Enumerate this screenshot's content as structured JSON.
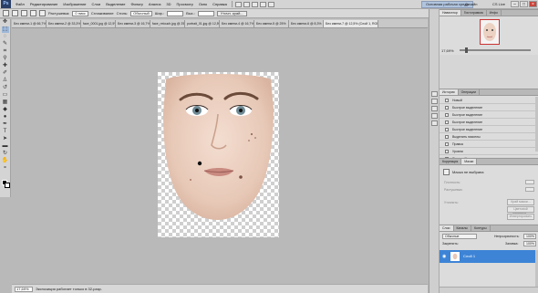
{
  "app": {
    "logo": "Ps"
  },
  "menu": {
    "items": [
      "Файл",
      "Редактирование",
      "Изображение",
      "Слои",
      "Выделение",
      "Фильтр",
      "Анализ",
      "3D",
      "Просмотр",
      "Окно",
      "Справка"
    ],
    "workspace": "Основная рабочая среда",
    "design": "Дизайн",
    "cs_live": "CS Live"
  },
  "options": {
    "tool_label": "Растушевка:",
    "feather_value": "0 пикс",
    "smoothing": "Сглаживание",
    "style_label": "Стиль:",
    "style_value": "Обычный",
    "width_label": "Шир.:",
    "height_label": "Выс.:",
    "refine_edge": "Уточн. край..."
  },
  "tabs": [
    {
      "label": "Без имени-1 @ 66,7% (RGB/8)",
      "active": false
    },
    {
      "label": "Без имени-2 @ 33,3% (RGB/8)",
      "active": false
    },
    {
      "label": "face_0001.jpg @ 12,5%",
      "active": false
    },
    {
      "label": "Без имени-3 @ 16,7%",
      "active": false
    },
    {
      "label": "face_retouch.jpg @ 25%",
      "active": false
    },
    {
      "label": "portrait_01.jpg @ 12,5%",
      "active": false
    },
    {
      "label": "Без имени-4 @ 16,7%",
      "active": false
    },
    {
      "label": "Без имени-5 @ 25%",
      "active": false
    },
    {
      "label": "Без имени-6 @ 8,3%",
      "active": false
    },
    {
      "label": "Без имени-7 @ 12,5% (Слой 1, RGB/8)",
      "active": true
    }
  ],
  "status": {
    "zoom": "17,69%",
    "info": "Экспозиция работает только в 32-разр."
  },
  "navigator": {
    "tabs": [
      "Навигатор",
      "Гистограмма",
      "Инфо"
    ],
    "zoom": "17,69%"
  },
  "history": {
    "tabs": [
      "История",
      "Операции"
    ],
    "items": [
      "Новый",
      "Быстрое выделение",
      "Быстрое выделение",
      "Быстрое выделение",
      "Быстрое выделение",
      "Выделить пикселы",
      "Правка",
      "Уровни",
      "Яркость/Контрастность",
      "Прямоугольная область",
      "Прямоугольная область"
    ],
    "selected_index": 10
  },
  "masks": {
    "tabs": [
      "Коррекция",
      "Маски"
    ],
    "title": "Маска не выбрана",
    "density_label": "Плотность:",
    "feather_label": "Растушевка:",
    "refine_label": "Уточнить:",
    "btn_mask_edge": "Край маски...",
    "btn_color_range": "Цветовой диапазон...",
    "btn_invert": "Инвертировать"
  },
  "layers": {
    "tabs": [
      "Слои",
      "Каналы",
      "Контуры"
    ],
    "blend_mode": "Обычные",
    "opacity_label": "Непрозрачность:",
    "opacity_value": "100%",
    "lock_label": "Закрепить:",
    "fill_label": "Заливка:",
    "fill_value": "100%",
    "layer_name": "Слой 1"
  },
  "colors": {
    "selection": "#3d84d6",
    "workspace_bg": "#b9b9b9",
    "panel_bg": "#d6d6d6",
    "navigator_frame": "#cc3333"
  }
}
